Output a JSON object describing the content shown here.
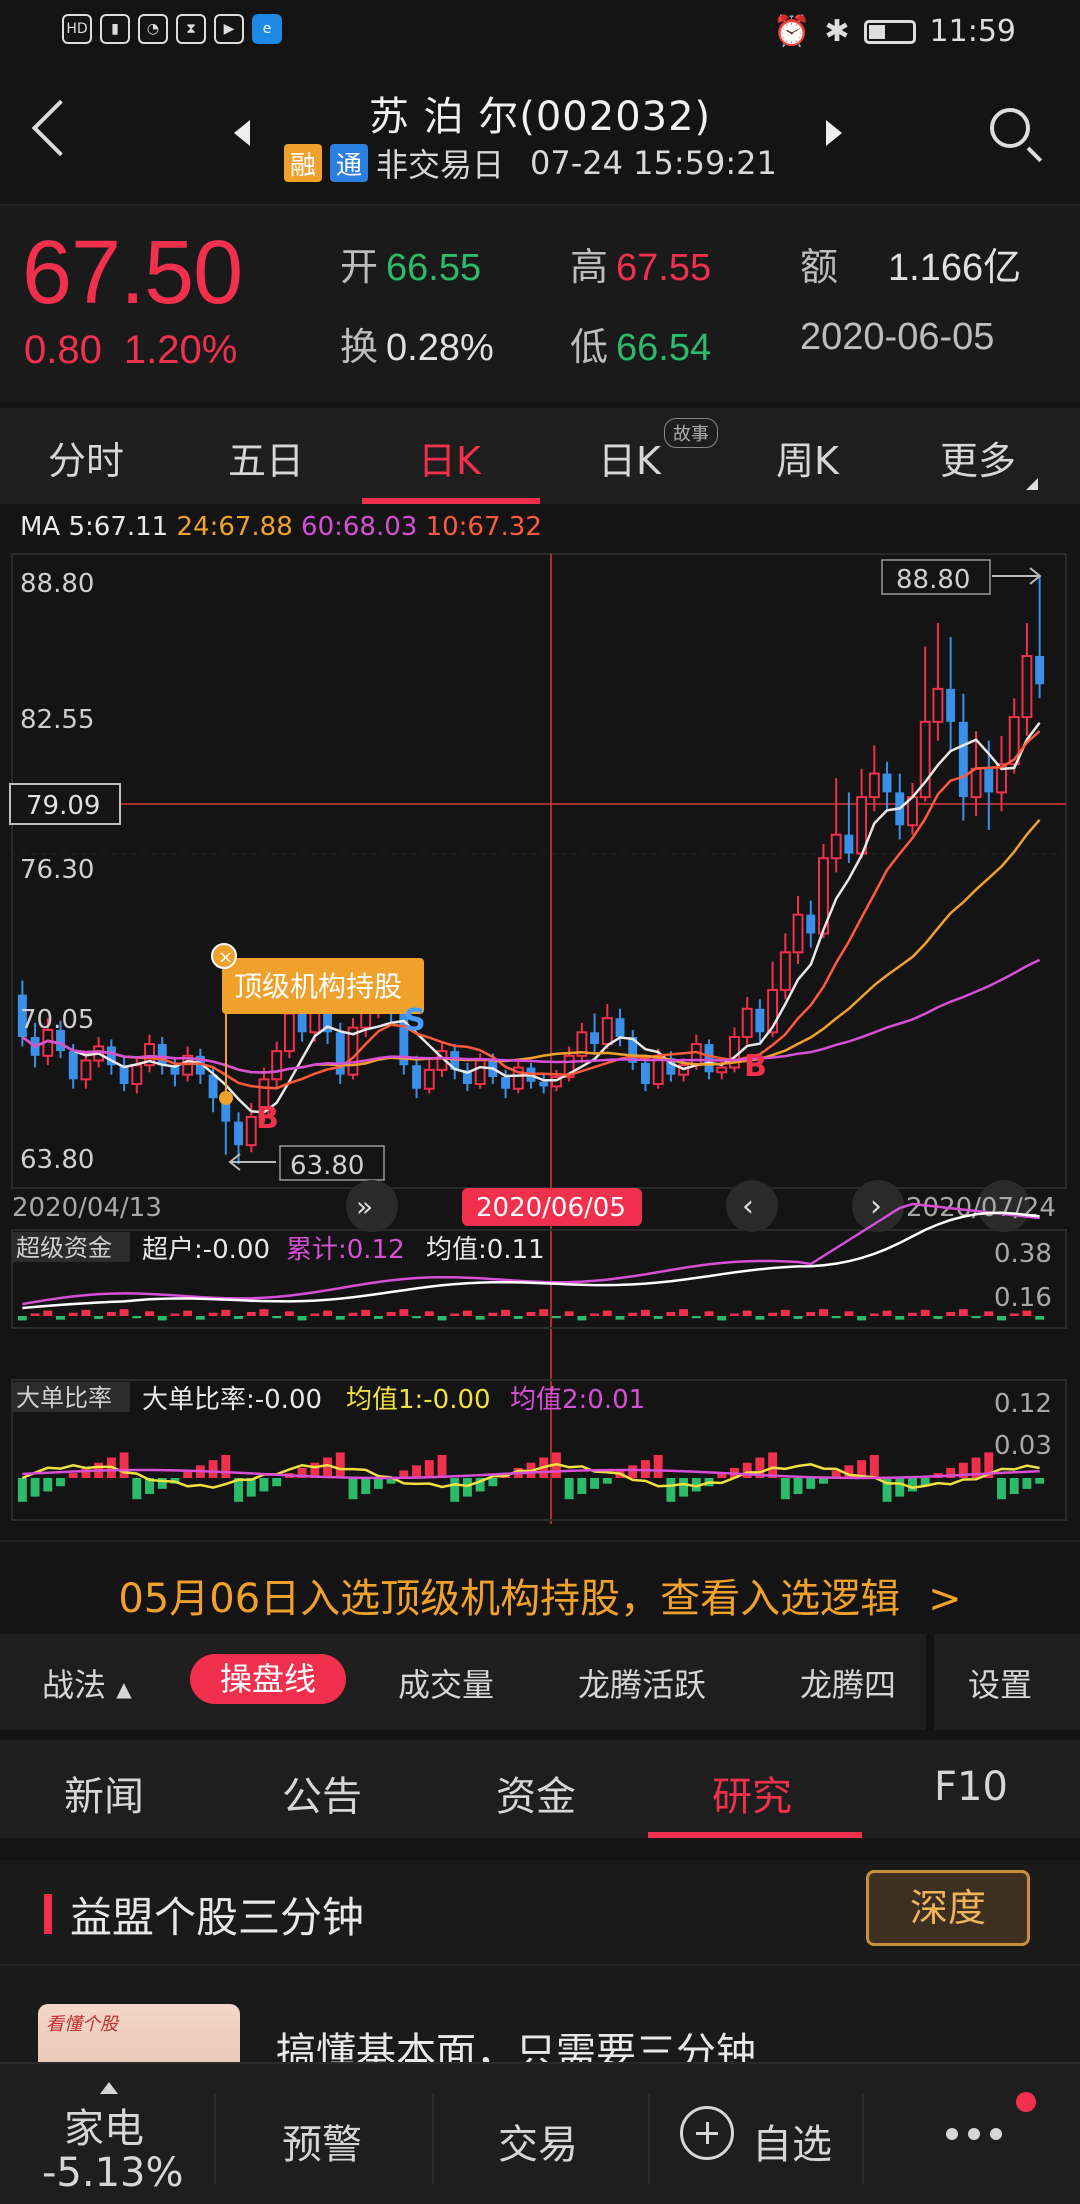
{
  "status_bar": {
    "left_icons": [
      "HD",
      "4G",
      "signal",
      "wifi-2",
      "hourglass",
      "play",
      "e"
    ],
    "time": "11:59"
  },
  "header": {
    "title": "苏 泊 尔(002032)",
    "tag_rong": "融",
    "tag_tong": "通",
    "status": "非交易日",
    "datetime": "07-24 15:59:21"
  },
  "quote": {
    "price": "67.50",
    "change": "0.80",
    "change_pct": "1.20%",
    "open_label": "开",
    "open": "66.55",
    "high_label": "高",
    "high": "67.55",
    "amount_label": "额",
    "amount": "1.166亿",
    "turnover_label": "换",
    "turnover": "0.28%",
    "low_label": "低",
    "low": "66.54",
    "date": "2020-06-05"
  },
  "ktabs": [
    "分时",
    "五日",
    "日K",
    "日K",
    "周K",
    "更多"
  ],
  "ktab_story_badge": "故事",
  "ma": {
    "ma5": "MA 5:67.11",
    "ma24": "24:67.88",
    "ma60": "60:68.03",
    "ma10": "10:67.32"
  },
  "chart_labels": {
    "y_top": "88.80",
    "y_2": "82.55",
    "y_crosshair": "79.09",
    "y_3": "76.30",
    "y_4": "70.05",
    "y_bottom": "63.80",
    "max_marker": "88.80",
    "min_marker": "63.80",
    "annotation": "顶级机构持股",
    "buy1": "B",
    "sell1": "S",
    "buy2": "B",
    "date_left": "2020/04/13",
    "date_selected": "2020/06/05",
    "date_right": "2020/07/24"
  },
  "ind1": {
    "name": "超级资金",
    "chaohu": "超户:-0.00",
    "leiji": "累计:0.12",
    "junzhi": "均值:0.11",
    "y_top": "0.38",
    "y_mid": "0.16"
  },
  "ind2": {
    "name": "大单比率",
    "ratio": "大单比率:-0.00",
    "avg1": "均值1:-0.00",
    "avg2": "均值2:0.01",
    "y_top": "0.12",
    "y_mid": "0.03"
  },
  "banner": {
    "text": "05月06日入选顶级机构持股，查看入选逻辑",
    "arrow": ">"
  },
  "indicator_tabs": {
    "zhanfa": "战法",
    "active": "操盘线",
    "items": [
      "成交量",
      "龙腾活跃",
      "龙腾四"
    ],
    "settings": "设置"
  },
  "news_tabs": [
    "新闻",
    "公告",
    "资金",
    "研究",
    "F10"
  ],
  "research": {
    "section_title": "益盟个股三分钟",
    "depth_button": "深度",
    "thumb_text": "看懂个股",
    "article_title": "搞懂基本面，只需要三分钟"
  },
  "bottom_nav": {
    "sector": "家电",
    "sector_change": "-5.13%",
    "alert": "预警",
    "trade": "交易",
    "watchlist": "自选"
  },
  "colors": {
    "up": "#f0304c",
    "down": "#2bbb6a",
    "accent_orange": "#f0a12c",
    "ma5": "#e8e8e8",
    "ma10": "#ff5a3c",
    "ma24": "#f0a12c",
    "ma60": "#d64fd6"
  },
  "chart_data": {
    "type": "candlestick",
    "price_range": [
      63.8,
      88.8
    ],
    "y_ticks": [
      88.8,
      82.55,
      76.3,
      70.05,
      63.8
    ],
    "dates": [
      "2020/04/13",
      "2020/06/05",
      "2020/07/24"
    ],
    "candles": [
      [
        71.0,
        69.2,
        71.6,
        68.8
      ],
      [
        69.2,
        68.4,
        69.8,
        67.9
      ],
      [
        68.4,
        69.5,
        70.0,
        68.0
      ],
      [
        69.5,
        68.6,
        69.9,
        68.3
      ],
      [
        68.6,
        67.4,
        68.9,
        67.0
      ],
      [
        67.4,
        68.2,
        68.6,
        67.0
      ],
      [
        68.2,
        68.8,
        69.2,
        67.9
      ],
      [
        68.8,
        68.0,
        69.1,
        67.6
      ],
      [
        68.0,
        67.2,
        68.4,
        66.9
      ],
      [
        67.2,
        68.0,
        68.3,
        66.8
      ],
      [
        68.0,
        68.9,
        69.3,
        67.7
      ],
      [
        68.9,
        68.0,
        69.2,
        67.6
      ],
      [
        68.0,
        67.6,
        68.3,
        67.1
      ],
      [
        67.6,
        68.4,
        68.8,
        67.3
      ],
      [
        68.4,
        67.6,
        68.7,
        67.2
      ],
      [
        67.6,
        66.6,
        67.9,
        66.0
      ],
      [
        66.6,
        65.6,
        67.0,
        64.2
      ],
      [
        65.6,
        64.6,
        66.0,
        63.8
      ],
      [
        64.6,
        65.8,
        66.4,
        64.3
      ],
      [
        65.8,
        67.4,
        67.9,
        65.6
      ],
      [
        67.4,
        68.6,
        69.0,
        67.0
      ],
      [
        68.6,
        70.2,
        70.8,
        68.3
      ],
      [
        70.2,
        69.4,
        71.0,
        69.0
      ],
      [
        69.4,
        70.6,
        71.2,
        69.0
      ],
      [
        70.6,
        69.4,
        70.9,
        68.9
      ],
      [
        69.4,
        67.6,
        69.8,
        67.2
      ],
      [
        67.6,
        69.6,
        70.0,
        67.4
      ],
      [
        69.6,
        70.4,
        70.9,
        69.2
      ],
      [
        70.4,
        71.2,
        71.7,
        70.0
      ],
      [
        71.2,
        70.2,
        71.5,
        69.8
      ],
      [
        70.2,
        68.0,
        70.4,
        67.6
      ],
      [
        68.0,
        67.0,
        68.4,
        66.6
      ],
      [
        67.0,
        67.8,
        68.3,
        66.8
      ],
      [
        67.8,
        68.6,
        69.0,
        67.5
      ],
      [
        68.6,
        67.8,
        68.9,
        67.4
      ],
      [
        67.8,
        67.2,
        68.1,
        66.9
      ],
      [
        67.2,
        68.2,
        68.5,
        67.0
      ],
      [
        68.2,
        67.5,
        68.5,
        67.2
      ],
      [
        67.5,
        67.0,
        67.8,
        66.6
      ],
      [
        67.0,
        67.9,
        68.2,
        66.8
      ],
      [
        67.9,
        67.3,
        68.1,
        67.0
      ],
      [
        67.3,
        67.1,
        67.6,
        66.8
      ],
      [
        67.1,
        67.5,
        67.8,
        66.9
      ],
      [
        67.5,
        68.4,
        68.8,
        67.3
      ],
      [
        68.4,
        69.4,
        69.8,
        68.1
      ],
      [
        69.4,
        68.9,
        70.2,
        68.5
      ],
      [
        68.9,
        70.0,
        70.6,
        68.7
      ],
      [
        70.0,
        69.2,
        70.4,
        68.8
      ],
      [
        69.2,
        68.1,
        69.5,
        67.8
      ],
      [
        68.1,
        67.2,
        68.4,
        66.9
      ],
      [
        67.2,
        68.3,
        68.7,
        67.0
      ],
      [
        68.3,
        67.6,
        68.6,
        67.3
      ],
      [
        67.6,
        68.0,
        68.3,
        67.3
      ],
      [
        68.0,
        68.9,
        69.3,
        67.8
      ],
      [
        68.9,
        67.7,
        69.1,
        67.4
      ],
      [
        67.7,
        67.9,
        68.2,
        67.4
      ],
      [
        67.9,
        69.2,
        69.6,
        67.7
      ],
      [
        69.2,
        70.4,
        70.9,
        68.9
      ],
      [
        70.4,
        69.4,
        70.8,
        69.0
      ],
      [
        69.4,
        71.2,
        72.4,
        69.2
      ],
      [
        71.2,
        72.8,
        73.6,
        70.8
      ],
      [
        72.8,
        74.4,
        75.2,
        72.3
      ],
      [
        74.4,
        73.6,
        75.0,
        73.0
      ],
      [
        73.6,
        76.8,
        77.4,
        73.4
      ],
      [
        76.8,
        77.8,
        80.2,
        76.2
      ],
      [
        77.8,
        77.0,
        79.6,
        76.6
      ],
      [
        77.0,
        79.4,
        80.6,
        76.8
      ],
      [
        79.4,
        80.4,
        81.6,
        78.8
      ],
      [
        80.4,
        79.6,
        80.9,
        78.8
      ],
      [
        79.6,
        78.2,
        80.4,
        77.6
      ],
      [
        78.2,
        79.4,
        80.0,
        77.8
      ],
      [
        79.4,
        82.6,
        85.8,
        79.2
      ],
      [
        82.6,
        84.0,
        86.8,
        81.8
      ],
      [
        84.0,
        82.6,
        86.2,
        81.4
      ],
      [
        82.6,
        79.4,
        83.8,
        78.4
      ],
      [
        79.4,
        80.6,
        82.2,
        78.6
      ],
      [
        80.6,
        79.6,
        81.8,
        78.0
      ],
      [
        79.6,
        80.8,
        82.0,
        78.8
      ],
      [
        80.8,
        82.8,
        83.6,
        80.4
      ],
      [
        82.8,
        85.4,
        86.8,
        82.0
      ],
      [
        85.4,
        84.2,
        88.8,
        83.6
      ]
    ],
    "ma_series": [
      "MA5",
      "MA10",
      "MA24",
      "MA60"
    ]
  }
}
